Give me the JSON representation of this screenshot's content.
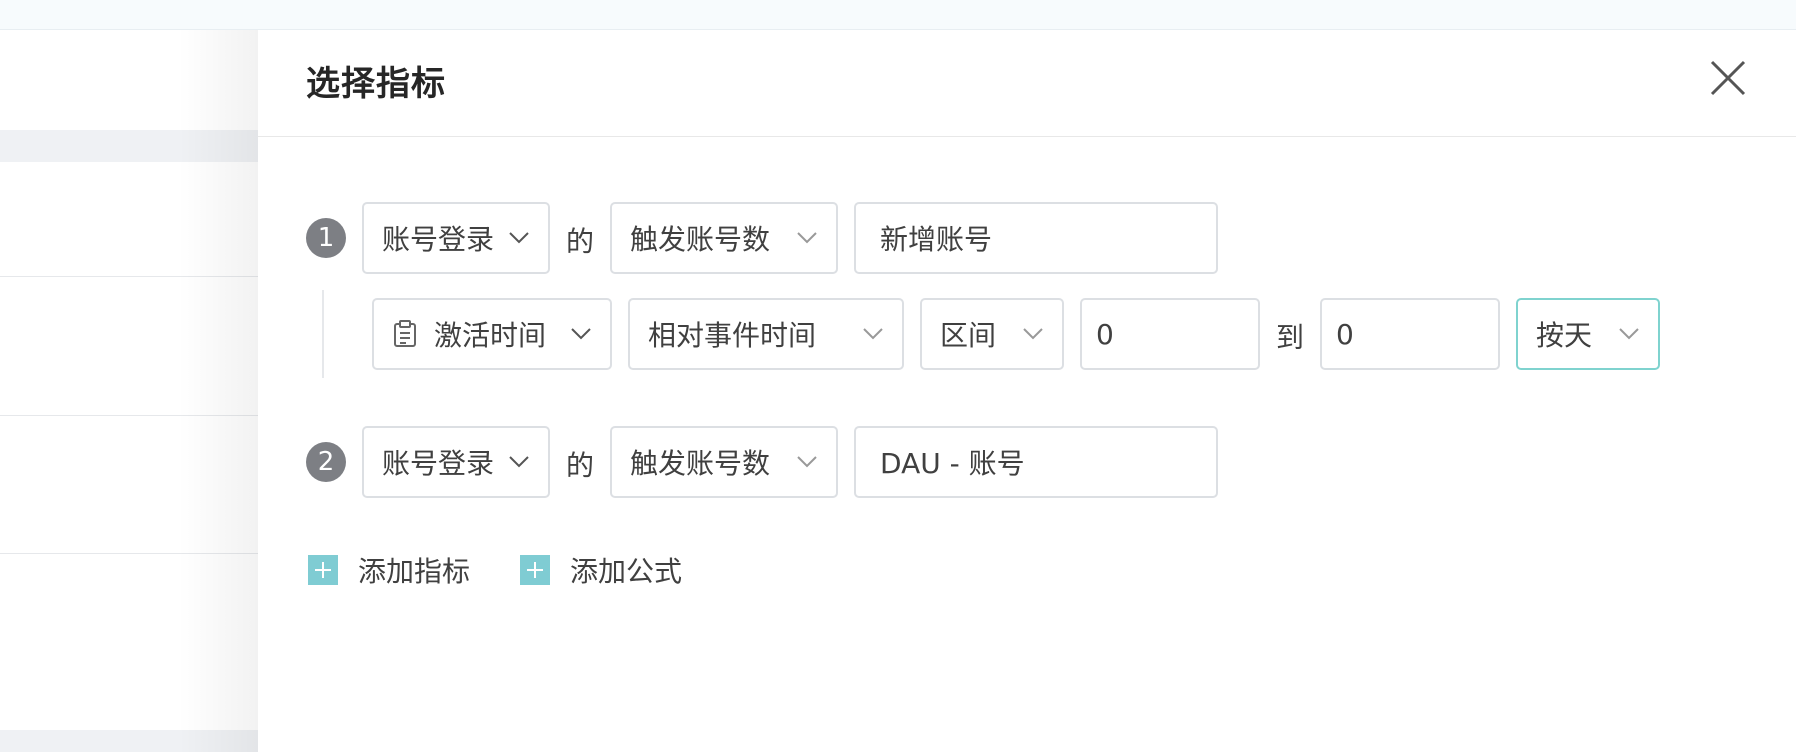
{
  "drawer": {
    "title": "选择指标"
  },
  "metrics": [
    {
      "index": "1",
      "event": "账号登录",
      "connector": "的",
      "measure": "触发账号数",
      "name": "新增账号",
      "filter": {
        "field": "激活时间",
        "field_icon": "calendar-icon",
        "relative": "相对事件时间",
        "range_type": "区间",
        "from": "0",
        "to_label": "到",
        "to": "0",
        "granularity": "按天"
      }
    },
    {
      "index": "2",
      "event": "账号登录",
      "connector": "的",
      "measure": "触发账号数",
      "name": "DAU - 账号"
    }
  ],
  "actions": {
    "add_metric": "添加指标",
    "add_formula": "添加公式"
  },
  "colors": {
    "accent": "#7fccd3",
    "badge": "#7d7f84",
    "focus_border": "#7fd3cf"
  }
}
